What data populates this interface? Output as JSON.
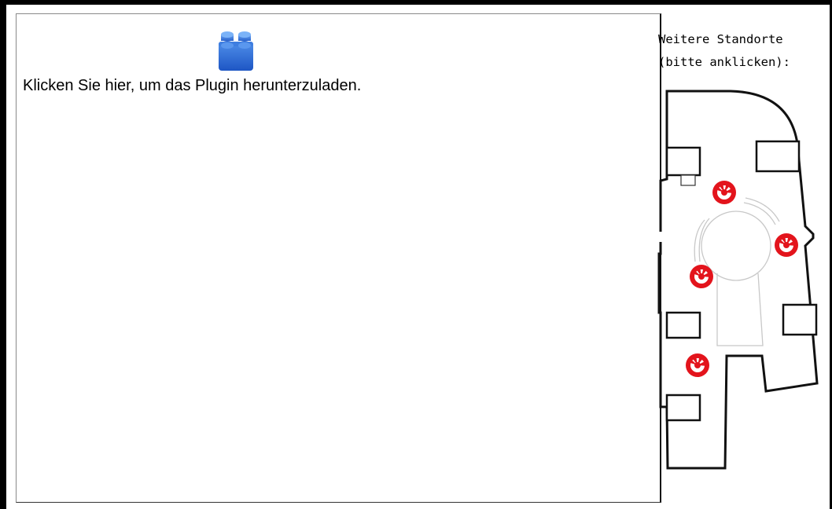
{
  "plugin": {
    "message": "Klicken Sie hier, um das Plugin herunterzuladen.",
    "icon": "plugin-brick-icon"
  },
  "locations": {
    "line1": "Weitere Standorte",
    "line2": "(bitte anklicken):",
    "marker_icon": "location-marker-icon",
    "marker_color": "#e3141c",
    "marker_count": 4
  }
}
